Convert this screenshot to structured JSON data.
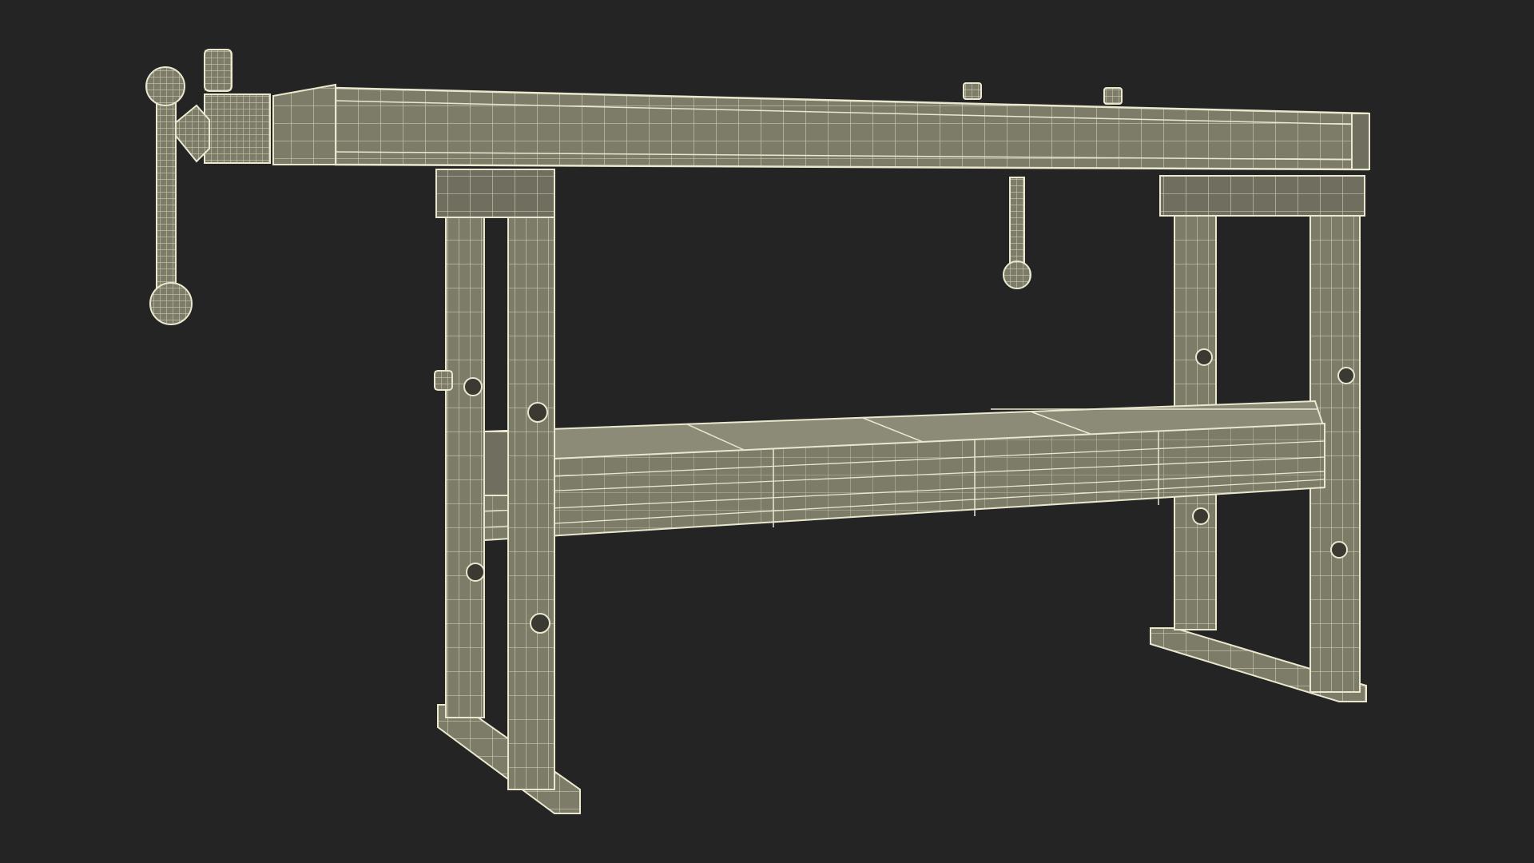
{
  "scene": {
    "subject": "wireframe-workbench-render",
    "colors": {
      "background": "#242424",
      "wood": "#7d7c69",
      "wood_dark": "#68675a",
      "wood_light": "#8c8b77",
      "wire": "#e9e8cf",
      "hole": "#3a3a33"
    }
  }
}
